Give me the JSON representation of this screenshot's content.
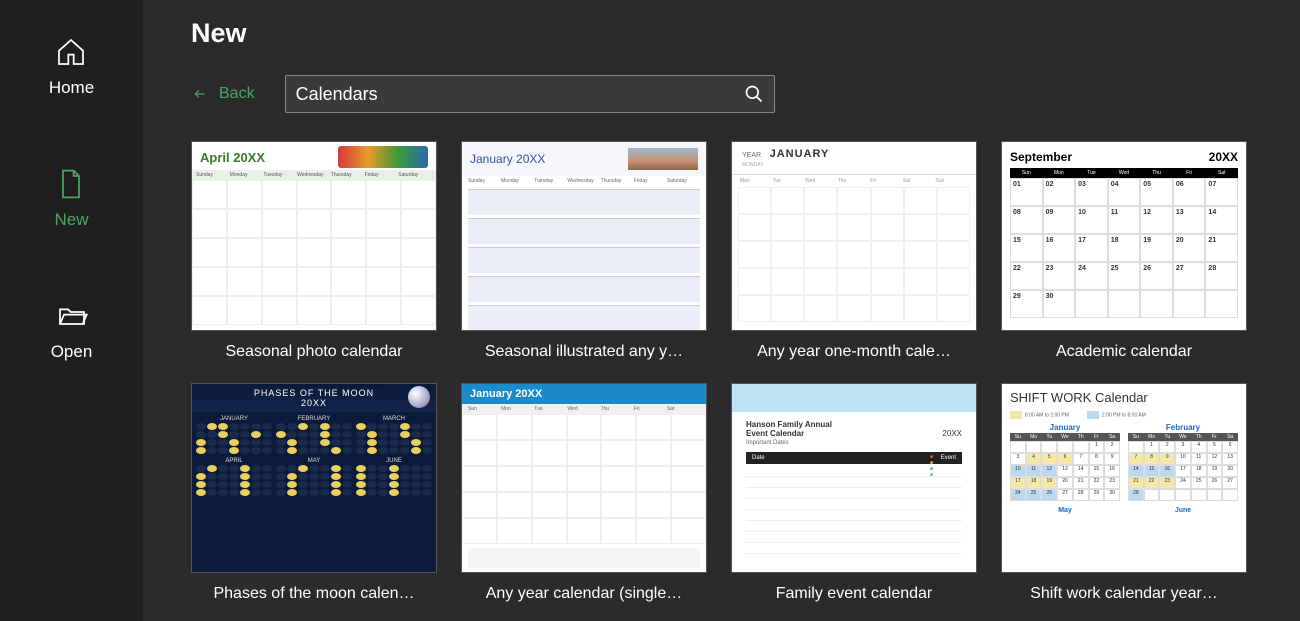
{
  "sidebar": {
    "home": "Home",
    "new": "New",
    "open": "Open"
  },
  "page": {
    "title": "New",
    "back": "Back"
  },
  "search": {
    "value": "Calendars"
  },
  "templates": [
    {
      "label": "Seasonal photo calendar"
    },
    {
      "label": "Seasonal illustrated any y…"
    },
    {
      "label": "Any year one-month cale…"
    },
    {
      "label": "Academic calendar"
    },
    {
      "label": "Phases of the moon calen…"
    },
    {
      "label": "Any year calendar (single…"
    },
    {
      "label": "Family event calendar"
    },
    {
      "label": "Shift work calendar year…"
    }
  ],
  "thumbs": {
    "t1_month": "April 20XX",
    "t2_month": "January 20XX",
    "t3_year": "YEAR",
    "t3_month": "JANUARY",
    "t3_sub": "MONDAY",
    "t4_month": "September",
    "t4_year": "20XX",
    "t5_title": "PHASES OF THE MOON",
    "t5_year": "20XX",
    "t5_m1": "JANUARY",
    "t5_m2": "FEBRUARY",
    "t5_m3": "MARCH",
    "t5_m4": "APRIL",
    "t5_m5": "MAY",
    "t5_m6": "JUNE",
    "t6_month": "January 20XX",
    "t7_title": "Hanson Family Annual",
    "t7_title2": "Event Calendar",
    "t7_year": "20XX",
    "t7_impdates": "Important Dates",
    "t8_title1": "SHIFT WORK",
    "t8_title2": "Calendar",
    "t8_shift1": "8:00 AM to 2:00 PM",
    "t8_shift2": "2:00 PM to 8:00 AM",
    "t8_m1": "January",
    "t8_m2": "February",
    "t8_m3": "May",
    "t8_m4": "June"
  }
}
